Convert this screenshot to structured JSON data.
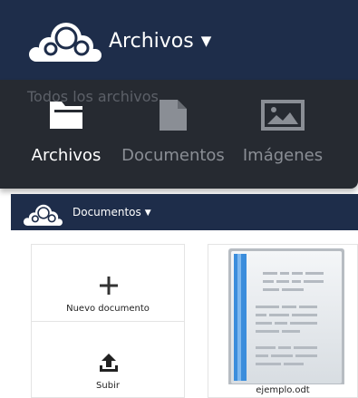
{
  "top_header": {
    "app_name": "Archivos",
    "caret": "▼"
  },
  "apps_menu": {
    "background_text": "Todos los archivos",
    "entries": [
      {
        "label": "Archivos",
        "icon": "folder-icon",
        "active": true
      },
      {
        "label": "Documentos",
        "icon": "document-icon",
        "active": false
      },
      {
        "label": "Imágenes",
        "icon": "image-icon",
        "active": false
      }
    ]
  },
  "small_header": {
    "app_name": "Documentos",
    "caret": "▼"
  },
  "actions": {
    "new_document": {
      "icon": "plus-icon",
      "label": "Nuevo documento"
    },
    "upload": {
      "icon": "upload-icon",
      "label": "Subir"
    }
  },
  "documents": [
    {
      "filename": "ejemplo.odt",
      "icon": "odt-document-thumbnail"
    }
  ],
  "colors": {
    "header": "#1e2d4a",
    "menu": "#262a31",
    "active_text": "#ffffff",
    "inactive_text": "#8a8e95",
    "thumbnail_stripe": "#3b8ddc"
  }
}
